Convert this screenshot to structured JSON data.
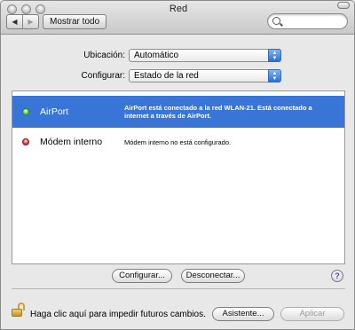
{
  "window": {
    "title": "Red"
  },
  "toolbar": {
    "back_glyph": "◀",
    "forward_glyph": "▶",
    "show_all_label": "Mostrar todo",
    "search_placeholder": ""
  },
  "form": {
    "location_label": "Ubicación:",
    "location_value": "Automático",
    "configure_label": "Configurar:",
    "configure_value": "Estado de la red"
  },
  "services": [
    {
      "name": "AirPort",
      "status_color": "#5fd44a",
      "description": "AirPort está conectado a la red WLAN-21. Está conectado a internet a través de AirPort.",
      "selected": true
    },
    {
      "name": "Módem interno",
      "status_color": "#e0342f",
      "description": "Módem interno no está configurado.",
      "selected": false
    }
  ],
  "actions": {
    "configure_label": "Configurar...",
    "disconnect_label": "Desconectar...",
    "help_glyph": "?"
  },
  "footer": {
    "lock_text": "Haga clic aquí para impedir futuros cambios.",
    "assistant_label": "Asistente...",
    "apply_label": "Aplicar"
  }
}
